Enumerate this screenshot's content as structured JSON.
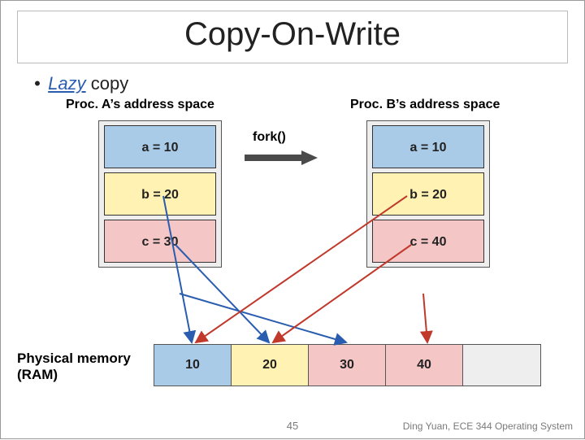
{
  "title": "Copy-On-Write",
  "bullet": {
    "marker": "•",
    "lazy": "Lazy",
    "rest": " copy"
  },
  "proc_a": {
    "title": "Proc. A’s address space",
    "cells": [
      {
        "text": "a = 10",
        "cls": "c-blue"
      },
      {
        "text": "b = 20",
        "cls": "c-yellow"
      },
      {
        "text": "c = 30",
        "cls": "c-pink"
      }
    ]
  },
  "proc_b": {
    "title": "Proc. B’s address space",
    "cells": [
      {
        "text": "a = 10",
        "cls": "c-blue"
      },
      {
        "text": "b = 20",
        "cls": "c-yellow"
      },
      {
        "text": "c = 40",
        "cls": "c-pink"
      }
    ]
  },
  "fork_label": "fork()",
  "phys": {
    "label_l1": "Physical memory",
    "label_l2": "(RAM)",
    "cells": [
      {
        "text": "10",
        "cls": "c-blue"
      },
      {
        "text": "20",
        "cls": "c-yellow"
      },
      {
        "text": "30",
        "cls": "c-pink"
      },
      {
        "text": "40",
        "cls": "c-pink"
      },
      {
        "text": "",
        "cls": "c-empty"
      }
    ]
  },
  "slide_number": "45",
  "credit": "Ding Yuan, ECE 344 Operating System"
}
